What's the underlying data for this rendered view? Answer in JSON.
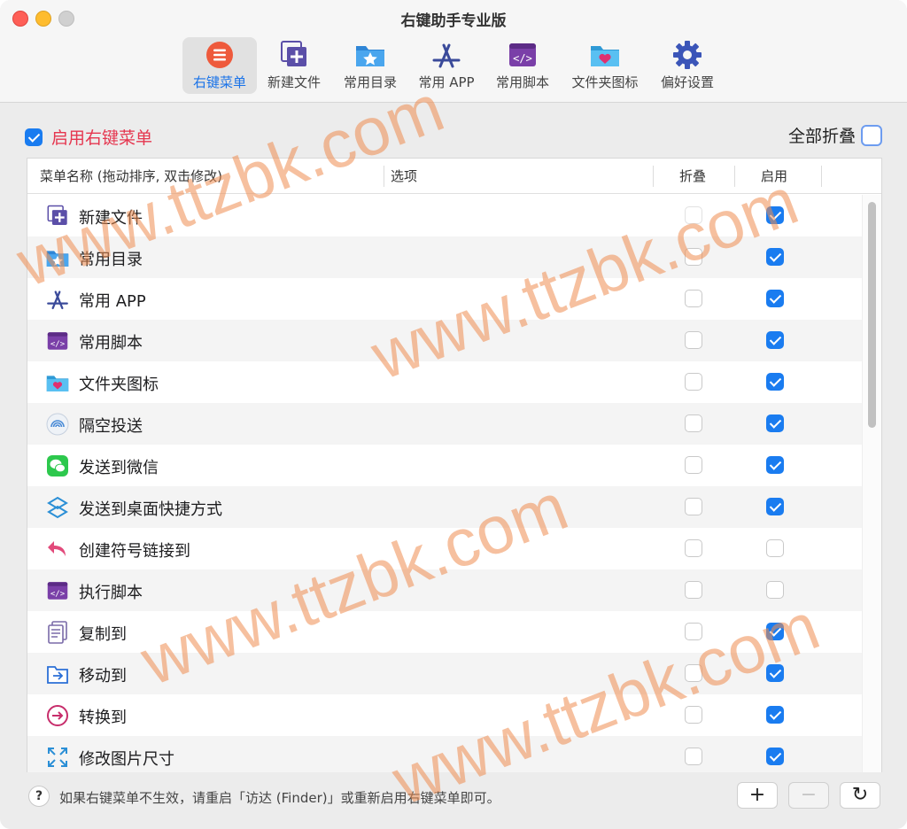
{
  "window": {
    "title": "右键助手专业版"
  },
  "toolbar": {
    "items": [
      {
        "label": "右键菜单",
        "icon": "right-menu-icon",
        "active": true
      },
      {
        "label": "新建文件",
        "icon": "new-file-icon",
        "active": false
      },
      {
        "label": "常用目录",
        "icon": "folder-star-icon",
        "active": false
      },
      {
        "label": "常用 APP",
        "icon": "app-store-icon",
        "active": false
      },
      {
        "label": "常用脚本",
        "icon": "script-icon",
        "active": false
      },
      {
        "label": "文件夹图标",
        "icon": "folder-heart-icon",
        "active": false
      },
      {
        "label": "偏好设置",
        "icon": "gear-icon",
        "active": false
      }
    ]
  },
  "options": {
    "enable_label": "启用右键菜单",
    "enable_checked": true,
    "collapse_all_label": "全部折叠",
    "collapse_all_checked": false
  },
  "table": {
    "columns": {
      "name": "菜单名称 (拖动排序, 双击修改)",
      "options": "选项",
      "fold": "折叠",
      "enable": "启用"
    },
    "rows": [
      {
        "name": "新建文件",
        "icon": "new-file-icon",
        "fold": false,
        "enabled": true
      },
      {
        "name": "常用目录",
        "icon": "folder-star-icon",
        "fold": false,
        "enabled": true
      },
      {
        "name": "常用 APP",
        "icon": "app-store-icon",
        "fold": false,
        "enabled": true
      },
      {
        "name": "常用脚本",
        "icon": "script-icon",
        "fold": false,
        "enabled": true
      },
      {
        "name": "文件夹图标",
        "icon": "folder-heart-icon",
        "fold": false,
        "enabled": true
      },
      {
        "name": "隔空投送",
        "icon": "airdrop-icon",
        "fold": false,
        "enabled": true
      },
      {
        "name": "发送到微信",
        "icon": "wechat-icon",
        "fold": false,
        "enabled": true
      },
      {
        "name": "发送到桌面快捷方式",
        "icon": "shortcut-icon",
        "fold": false,
        "enabled": true
      },
      {
        "name": "创建符号链接到",
        "icon": "symlink-icon",
        "fold": false,
        "enabled": false
      },
      {
        "name": "执行脚本",
        "icon": "script-icon",
        "fold": false,
        "enabled": false
      },
      {
        "name": "复制到",
        "icon": "copy-icon",
        "fold": false,
        "enabled": true
      },
      {
        "name": "移动到",
        "icon": "move-icon",
        "fold": false,
        "enabled": true
      },
      {
        "name": "转换到",
        "icon": "convert-icon",
        "fold": false,
        "enabled": true
      },
      {
        "name": "修改图片尺寸",
        "icon": "resize-icon",
        "fold": false,
        "enabled": true
      }
    ]
  },
  "footer": {
    "help": "?",
    "hint": "如果右键菜单不生效，请重启「访达 (Finder)」或重新启用右键菜单即可。",
    "add": "+",
    "remove": "−",
    "refresh": "↻"
  },
  "watermark": "www.ttzbk.com",
  "colors": {
    "accent": "#1a7cf0",
    "enable_label": "#e5364f",
    "watermark": "#ee8c50"
  }
}
